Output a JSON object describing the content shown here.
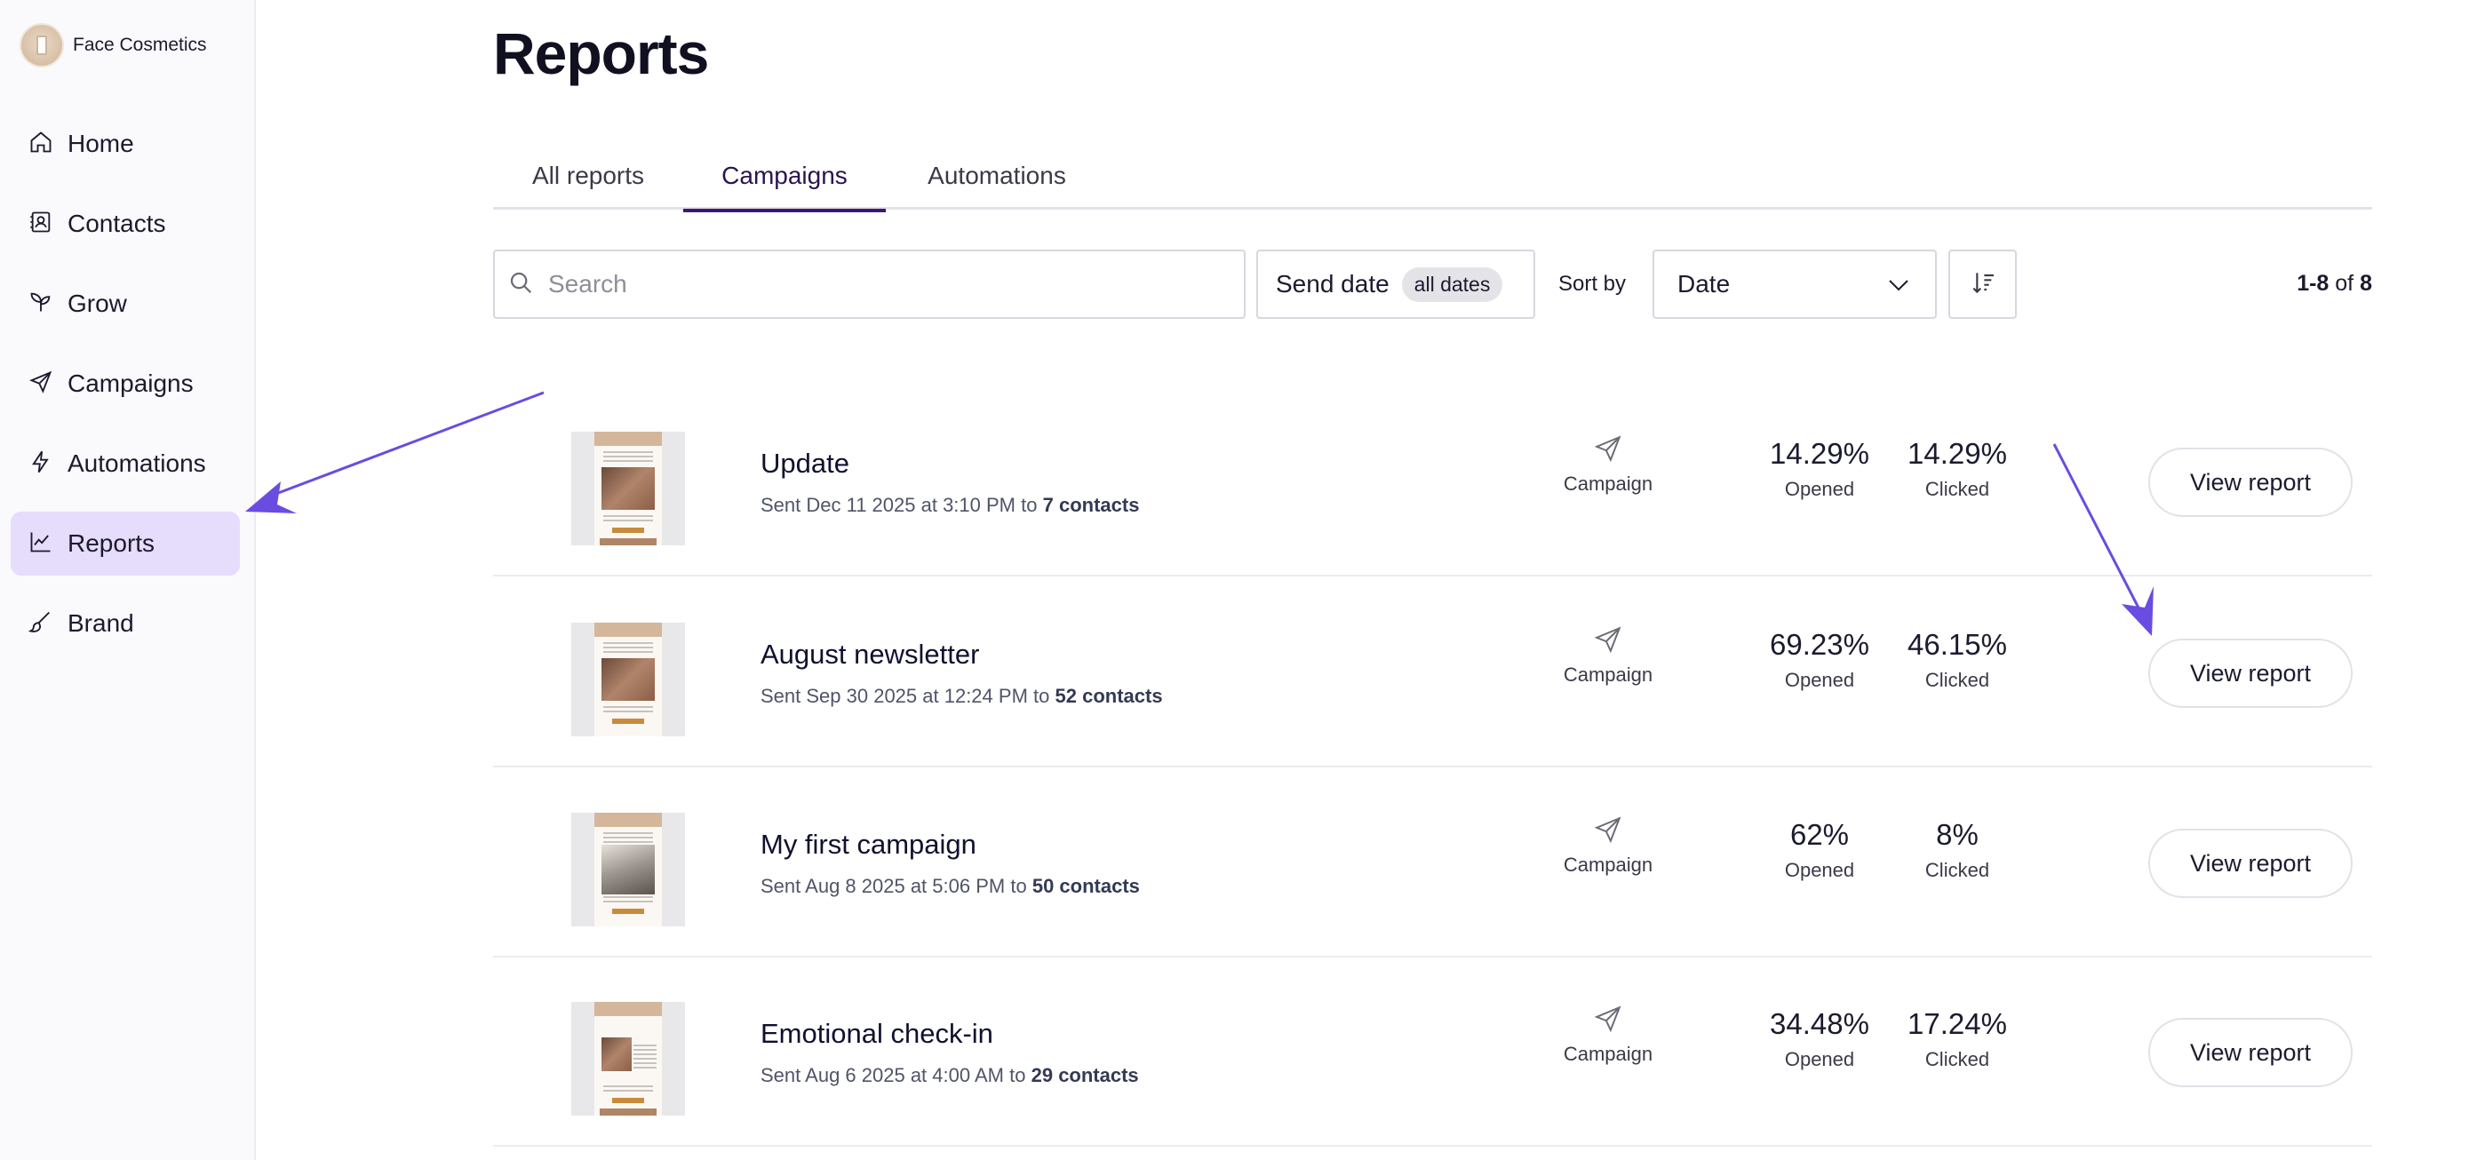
{
  "brand": {
    "name": "Face Cosmetics"
  },
  "sidebar": {
    "items": [
      {
        "label": "Home",
        "icon": "home-icon",
        "active": false
      },
      {
        "label": "Contacts",
        "icon": "contacts-icon",
        "active": false
      },
      {
        "label": "Grow",
        "icon": "sprout-icon",
        "active": false
      },
      {
        "label": "Campaigns",
        "icon": "send-icon",
        "active": false
      },
      {
        "label": "Automations",
        "icon": "lightning-icon",
        "active": false
      },
      {
        "label": "Reports",
        "icon": "chart-line-icon",
        "active": true
      },
      {
        "label": "Brand",
        "icon": "brush-icon",
        "active": false
      }
    ]
  },
  "page": {
    "title": "Reports"
  },
  "tabs": [
    {
      "label": "All reports",
      "active": false
    },
    {
      "label": "Campaigns",
      "active": true
    },
    {
      "label": "Automations",
      "active": false
    }
  ],
  "toolbar": {
    "search_placeholder": "Search",
    "send_date_label": "Send date",
    "send_date_value": "all dates",
    "sort_by_label": "Sort by",
    "sort_value": "Date",
    "pager": {
      "range": "1-8",
      "of_word": "of",
      "total": "8"
    }
  },
  "reports": [
    {
      "name": "Update",
      "sent_prefix": "Sent Dec 11 2025 at 3:10 PM",
      "to_word": "to",
      "contacts": "7 contacts",
      "type": "Campaign",
      "opened": "14.29%",
      "clicked": "14.29%",
      "opened_label": "Opened",
      "clicked_label": "Clicked",
      "button": "View report"
    },
    {
      "name": "August newsletter",
      "sent_prefix": "Sent Sep 30 2025 at 12:24 PM",
      "to_word": "to",
      "contacts": "52 contacts",
      "type": "Campaign",
      "opened": "69.23%",
      "clicked": "46.15%",
      "opened_label": "Opened",
      "clicked_label": "Clicked",
      "button": "View report"
    },
    {
      "name": "My first campaign",
      "sent_prefix": "Sent Aug 8 2025 at 5:06 PM",
      "to_word": "to",
      "contacts": "50 contacts",
      "type": "Campaign",
      "opened": "62%",
      "clicked": "8%",
      "opened_label": "Opened",
      "clicked_label": "Clicked",
      "button": "View report"
    },
    {
      "name": "Emotional check-in",
      "sent_prefix": "Sent Aug 6 2025 at 4:00 AM",
      "to_word": "to",
      "contacts": "29 contacts",
      "type": "Campaign",
      "opened": "34.48%",
      "clicked": "17.24%",
      "opened_label": "Opened",
      "clicked_label": "Clicked",
      "button": "View report"
    }
  ],
  "colors": {
    "accent": "#3b1a73",
    "active_nav_bg": "#e6dcfb",
    "annotation_arrow": "#6a4ce0"
  }
}
